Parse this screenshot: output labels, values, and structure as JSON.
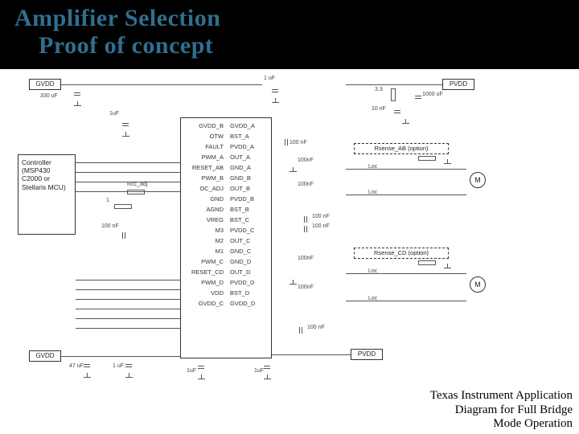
{
  "title": {
    "line1": "Amplifier Selection",
    "line2": "Proof of concept"
  },
  "caption": {
    "line1": "Texas Instrument Application",
    "line2": "Diagram  for Full Bridge",
    "line3": "Mode Operation"
  },
  "rails": {
    "gvdd": "GVDD",
    "pvdd": "PVDD"
  },
  "controller": {
    "label": "Controller (MSP430 C2000 or Stellaris MCU)"
  },
  "components": {
    "c_330u": "330 uF",
    "c_1u_a": "1uF",
    "c_1u_b": "1 uF",
    "c_1u_c": "1 uF",
    "c_1u_d": "1uF",
    "c_1u_e": "1uF",
    "c_47u": "47 uF",
    "c_1000u": "1000 uF",
    "c_100n_a": "100 nF",
    "c_100n_b": "100nF",
    "c_100n_c": "100 nF",
    "c_100n_d": "100 nF",
    "c_100n_e": "100nF",
    "c_100n_f": "100nF",
    "c_100n_g": "100 nF",
    "c_100n_h": "100 nF",
    "c_10n": "10 nF",
    "r_3_3": "3.3",
    "r_1": "1",
    "rcc_adj": "Rcc_adj",
    "rsense_ab": "Rsense_AB (option)",
    "rsense_cd": "Rsense_CD (option)",
    "loc1": "Loc",
    "loc2": "Loc",
    "loc3": "Loc",
    "loc4": "Loc",
    "motor": "M"
  },
  "chip": {
    "left_pins": [
      "GVDD_B",
      "OTW",
      "FAULT",
      "PWM_A",
      "RESET_AB",
      "PWM_B",
      "OC_ADJ",
      "GND",
      "AGND",
      "VREG",
      "M3",
      "M2",
      "M1",
      "PWM_C",
      "RESET_CD",
      "PWM_D",
      "VDD",
      "GVDD_C"
    ],
    "right_pins": [
      "GVDD_A",
      "BST_A",
      "PVDD_A",
      "OUT_A",
      "GND_A",
      "GND_B",
      "OUT_B",
      "PVDD_B",
      "BST_B",
      "BST_C",
      "PVDD_C",
      "OUT_C",
      "GND_C",
      "GND_D",
      "OUT_D",
      "PVDD_D",
      "BST_D",
      "GVDD_D"
    ]
  }
}
